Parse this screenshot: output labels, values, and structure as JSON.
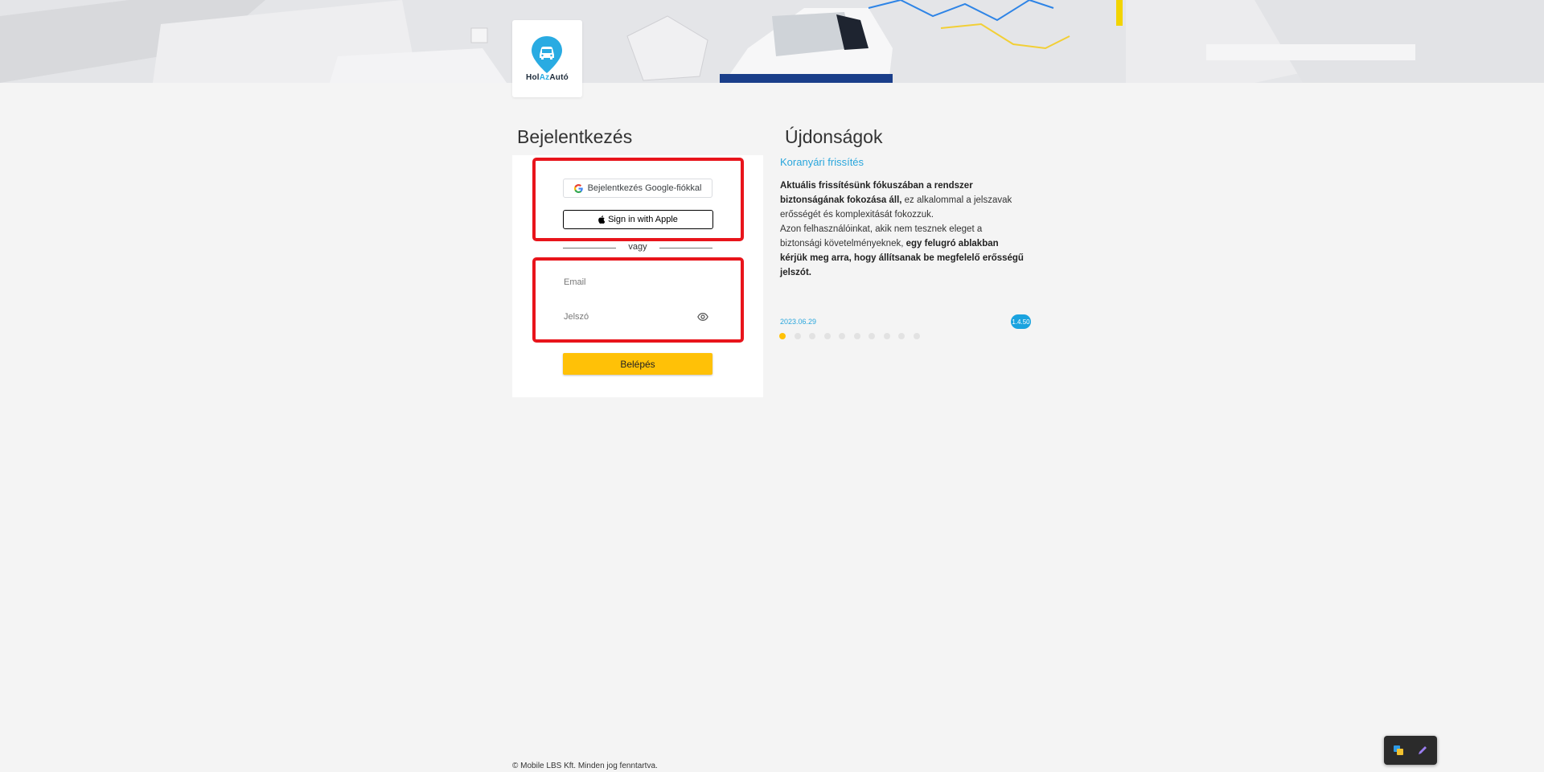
{
  "brand": {
    "logo_text_prefix": "Hol",
    "logo_text_mid": "Az",
    "logo_text_suffix": "Autó"
  },
  "login": {
    "title": "Bejelentkezés",
    "google_label": "Bejelentkezés Google-fiókkal",
    "apple_label": "Sign in with Apple",
    "divider_text": "vagy",
    "email_placeholder": "Email",
    "password_placeholder": "Jelszó",
    "submit_label": "Belépés"
  },
  "news": {
    "title": "Újdonságok",
    "item_title": "Koranyári frissítés",
    "p1_bold": "Aktuális frissítésünk fókuszában a rendszer biztonságának fokozása áll,",
    "p1_rest": " ez alkalommal a jelszavak erősségét és komplexitását fokozzuk.",
    "p2_start": "Azon felhasználóinkat, akik nem tesznek eleget a biztonsági követelményeknek, ",
    "p2_bold": "egy felugró ablakban kérjük meg arra, hogy állítsanak be megfelelő erősségű jelszót.",
    "date": "2023.06.29",
    "version": "1.4.50",
    "dot_count": 10,
    "active_dot": 0
  },
  "footer": {
    "copyright": "© Mobile LBS Kft. Minden jog fenntartva."
  },
  "colors": {
    "accent_blue": "#29a6dc",
    "primary_yellow": "#ffc107",
    "highlight_red": "#e8141b"
  },
  "icons": {
    "google": "google-g-icon",
    "apple": "apple-icon",
    "eye": "eye-icon",
    "widget_left": "translate-icon",
    "widget_right": "pen-icon"
  }
}
